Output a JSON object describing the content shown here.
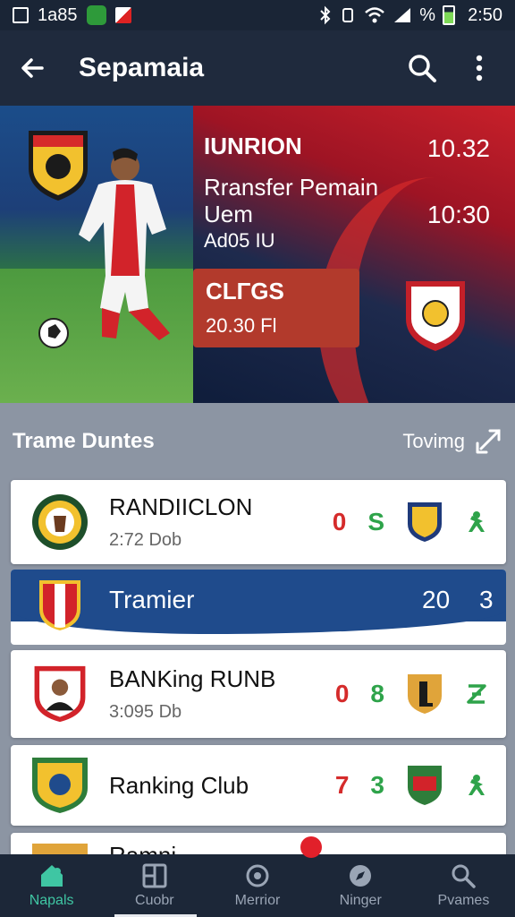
{
  "status_bar": {
    "left_text": "1a85",
    "time": "2:50",
    "signal_text": "%"
  },
  "app_bar": {
    "title": "Sepamaia"
  },
  "hero": {
    "heading": "IUNRION",
    "time_1": "10.32",
    "line_1": "Rransfer Pemain",
    "line_2": "Uem",
    "time_2": "10:30",
    "line_3": "Ad05 IU",
    "tag_title": "CLΓGS",
    "tag_sub": "20.30 Fl"
  },
  "section": {
    "title": "Trame Duntes",
    "link": "Tovimg"
  },
  "clubs": [
    {
      "name": "RANDIICLON",
      "sub": "2:72 Dob",
      "score_a": "0",
      "score_b": "S"
    },
    {
      "name": "BANKing RUNB",
      "sub": "3:095 Db",
      "score_a": "0",
      "score_b": "8"
    },
    {
      "name": "Ranking Club",
      "score_a": "7",
      "score_b": "3"
    }
  ],
  "banner": {
    "name": "Tramier",
    "value_1": "20",
    "value_2": "3"
  },
  "partial_row": {
    "name": "Ramni"
  },
  "bottom_nav": [
    {
      "label": "Napals",
      "icon": "home-icon",
      "active": true
    },
    {
      "label": "Cuobr",
      "icon": "grid-icon",
      "active": false
    },
    {
      "label": "Merrior",
      "icon": "target-icon",
      "active": false
    },
    {
      "label": "Ninger",
      "icon": "compass-icon",
      "active": false
    },
    {
      "label": "Pvames",
      "icon": "search-icon",
      "active": false
    }
  ],
  "colors": {
    "accent": "#3fc6a3",
    "app_bar": "#1f2a3d",
    "banner_blue": "#1f4b8c",
    "score_red": "#d52b2b",
    "score_green": "#2ea34a"
  }
}
